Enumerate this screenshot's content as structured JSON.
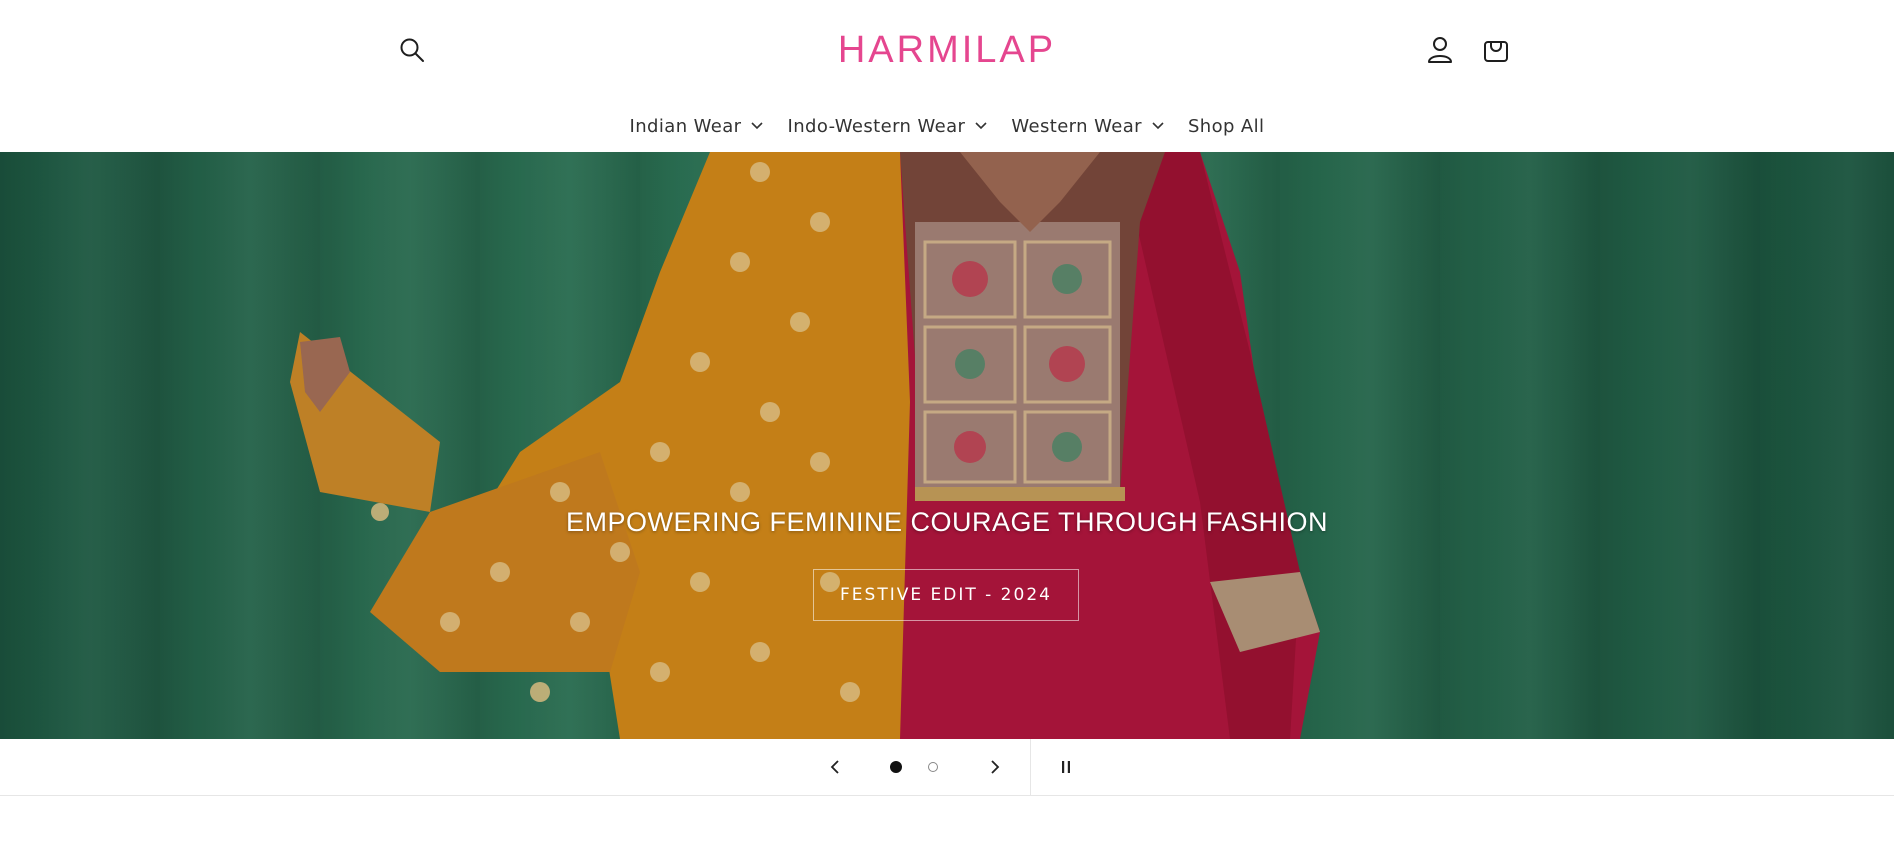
{
  "header": {
    "logo_text": "HARMILAP",
    "logo_color": "#e5468f",
    "search_icon": "search-icon",
    "account_icon": "account-icon",
    "cart_icon": "cart-icon"
  },
  "nav": {
    "items": [
      {
        "label": "Indian Wear",
        "has_dropdown": true
      },
      {
        "label": "Indo-Western Wear",
        "has_dropdown": true
      },
      {
        "label": "Western Wear",
        "has_dropdown": true
      },
      {
        "label": "Shop All",
        "has_dropdown": false
      }
    ]
  },
  "hero": {
    "heading": "EMPOWERING FEMININE COURAGE THROUGH FASHION",
    "button_label": "FESTIVE EDIT - 2024"
  },
  "slider": {
    "current_slide": 1,
    "total_slides": 2,
    "prev_icon": "chevron-left-icon",
    "next_icon": "chevron-right-icon",
    "pause_icon": "pause-icon"
  }
}
